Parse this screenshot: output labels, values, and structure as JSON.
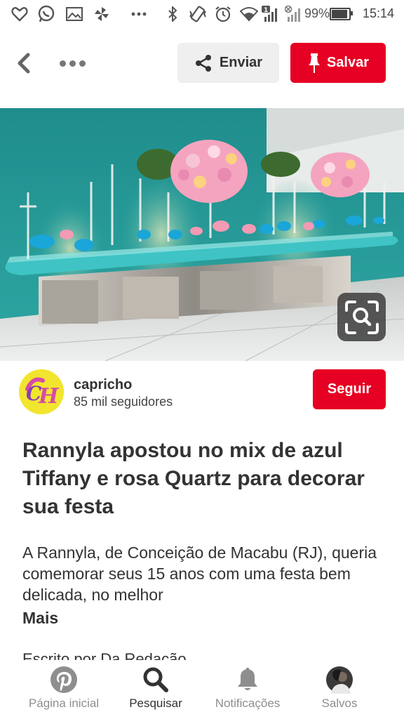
{
  "status_bar": {
    "battery_percent": "99%",
    "battery_level": 0.99,
    "time": "15:14",
    "icons": [
      "heart-outline-icon",
      "whatsapp-icon",
      "image-icon",
      "pinwheel-icon",
      "more-dots-icon",
      "bluetooth-icon",
      "vibrate-icon",
      "alarm-icon",
      "wifi-icon",
      "signal-icon",
      "signal-disabled-icon",
      "battery-icon"
    ]
  },
  "toolbar": {
    "send_label": "Enviar",
    "save_label": "Salvar"
  },
  "pin": {
    "author_name": "capricho",
    "author_followers": "85 mil seguidores",
    "follow_label": "Seguir",
    "title": "Rannyla apostou no mix de azul Tiffany e rosa Quartz para decorar sua festa",
    "description": "A Rannyla, de Conceição de Macabu (RJ), queria comemorar seus 15 anos com uma festa bem delicada, no melhor",
    "more_label": "Mais",
    "byline": "Escrito por Da Redação"
  },
  "nav": {
    "items": [
      {
        "label": "Página inicial",
        "icon": "pinterest-logo-icon"
      },
      {
        "label": "Pesquisar",
        "icon": "search-icon"
      },
      {
        "label": "Notificações",
        "icon": "bell-icon"
      },
      {
        "label": "Salvos",
        "icon": "profile-avatar-icon"
      }
    ]
  },
  "colors": {
    "brand_red": "#e60023",
    "button_gray": "#efefef",
    "tiffany_blue": "#3fc3c4"
  }
}
